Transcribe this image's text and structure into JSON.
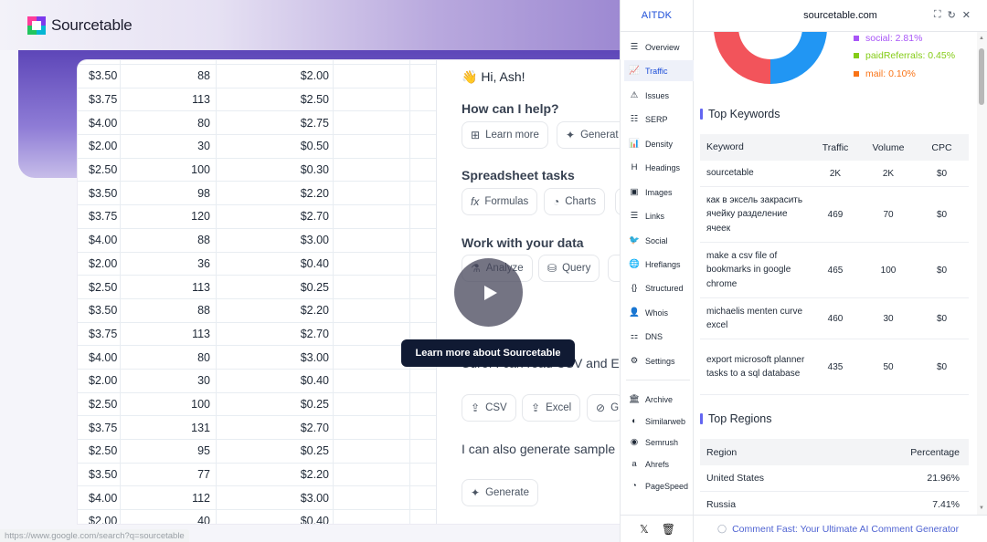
{
  "site": {
    "logo_text": "Sourcetable",
    "sheet_rows": [
      [
        "$3.50",
        "88",
        "$2.00"
      ],
      [
        "$3.75",
        "113",
        "$2.50"
      ],
      [
        "$4.00",
        "80",
        "$2.75"
      ],
      [
        "$2.00",
        "30",
        "$0.50"
      ],
      [
        "$2.50",
        "100",
        "$0.30"
      ],
      [
        "$3.50",
        "98",
        "$2.20"
      ],
      [
        "$3.75",
        "120",
        "$2.70"
      ],
      [
        "$4.00",
        "88",
        "$3.00"
      ],
      [
        "$2.00",
        "36",
        "$0.40"
      ],
      [
        "$2.50",
        "113",
        "$0.25"
      ],
      [
        "$3.50",
        "88",
        "$2.20"
      ],
      [
        "$3.75",
        "113",
        "$2.70"
      ],
      [
        "$4.00",
        "80",
        "$3.00"
      ],
      [
        "$2.00",
        "30",
        "$0.40"
      ],
      [
        "$2.50",
        "100",
        "$0.25"
      ],
      [
        "$3.75",
        "131",
        "$2.70"
      ],
      [
        "$2.50",
        "95",
        "$0.25"
      ],
      [
        "$3.50",
        "77",
        "$2.20"
      ],
      [
        "$4.00",
        "112",
        "$3.00"
      ],
      [
        "$2.00",
        "40",
        "$0.40"
      ]
    ],
    "chat": {
      "greeting": "👋 Hi, Ash!",
      "help_title": "How can I help?",
      "chip_learn_more": "Learn more",
      "chip_generate_top": "Generat",
      "spreadsheet_title": "Spreadsheet tasks",
      "chip_formulas": "Formulas",
      "chip_charts": "Charts",
      "data_title": "Work with your data",
      "chip_analyze": "Analyze",
      "chip_query": "Query",
      "csv_text": "Sure! I can read CSV and Ex",
      "chip_csv": "CSV",
      "chip_excel": "Excel",
      "chip_g": "G",
      "generate_text": "I can also generate sample",
      "chip_generate_bottom": "Generate"
    },
    "video_cta": "Learn more about Sourcetable",
    "status_url": "https://www.google.com/search?q=sourcetable"
  },
  "ext": {
    "brand": "AITDK",
    "domain": "sourcetable.com",
    "nav": [
      {
        "label": "Overview",
        "icon": "overview-icon",
        "glyph": "☰"
      },
      {
        "label": "Traffic",
        "icon": "traffic-icon",
        "glyph": "📈"
      },
      {
        "label": "Issues",
        "icon": "issues-icon",
        "glyph": "⚠"
      },
      {
        "label": "SERP",
        "icon": "serp-icon",
        "glyph": "☷"
      },
      {
        "label": "Density",
        "icon": "density-icon",
        "glyph": "📊"
      },
      {
        "label": "Headings",
        "icon": "headings-icon",
        "glyph": "H"
      },
      {
        "label": "Images",
        "icon": "images-icon",
        "glyph": "▣"
      },
      {
        "label": "Links",
        "icon": "links-icon",
        "glyph": "☰"
      },
      {
        "label": "Social",
        "icon": "social-icon",
        "glyph": "🐦"
      },
      {
        "label": "Hreflangs",
        "icon": "hreflangs-icon",
        "glyph": "🌐"
      },
      {
        "label": "Structured",
        "icon": "structured-icon",
        "glyph": "{}"
      },
      {
        "label": "Whois",
        "icon": "whois-icon",
        "glyph": "👤"
      },
      {
        "label": "DNS",
        "icon": "dns-icon",
        "glyph": "⚏"
      },
      {
        "label": "Settings",
        "icon": "settings-icon",
        "glyph": "⚙"
      },
      {
        "label": "Archive",
        "icon": "archive-icon",
        "glyph": "🏛"
      },
      {
        "label": "Similarweb",
        "icon": "similarweb-icon",
        "glyph": "◐"
      },
      {
        "label": "Semrush",
        "icon": "semrush-icon",
        "glyph": "◉"
      },
      {
        "label": "Ahrefs",
        "icon": "ahrefs-icon",
        "glyph": "a"
      },
      {
        "label": "PageSpeed",
        "icon": "pagespeed-icon",
        "glyph": "◔"
      }
    ],
    "traffic_legend": [
      {
        "label": "social: 2.81%",
        "color": "#a855f7"
      },
      {
        "label": "paidReferrals: 0.45%",
        "color": "#84cc16"
      },
      {
        "label": "mail: 0.10%",
        "color": "#f97316"
      }
    ],
    "donut_colors": {
      "red": "#f2545b",
      "blue": "#2196f3"
    },
    "keywords_title": "Top Keywords",
    "keywords_headers": {
      "keyword": "Keyword",
      "traffic": "Traffic",
      "volume": "Volume",
      "cpc": "CPC"
    },
    "keywords": [
      {
        "keyword": "sourcetable",
        "traffic": "2K",
        "volume": "2K",
        "cpc": "$0"
      },
      {
        "keyword": "как в эксель закрасить ячейку разделение ячеек",
        "traffic": "469",
        "volume": "70",
        "cpc": "$0"
      },
      {
        "keyword": "make a csv file of bookmarks in google chrome",
        "traffic": "465",
        "volume": "100",
        "cpc": "$0"
      },
      {
        "keyword": "michaelis menten curve excel",
        "traffic": "460",
        "volume": "30",
        "cpc": "$0"
      },
      {
        "keyword": "export microsoft planner tasks to a sql database",
        "traffic": "435",
        "volume": "50",
        "cpc": "$0"
      }
    ],
    "regions_title": "Top Regions",
    "regions_headers": {
      "region": "Region",
      "percentage": "Percentage"
    },
    "regions": [
      {
        "region": "United States",
        "percentage": "21.96%"
      },
      {
        "region": "Russia",
        "percentage": "7.41%"
      }
    ],
    "footer_link": "Comment Fast: Your Ultimate AI Comment Generator"
  }
}
